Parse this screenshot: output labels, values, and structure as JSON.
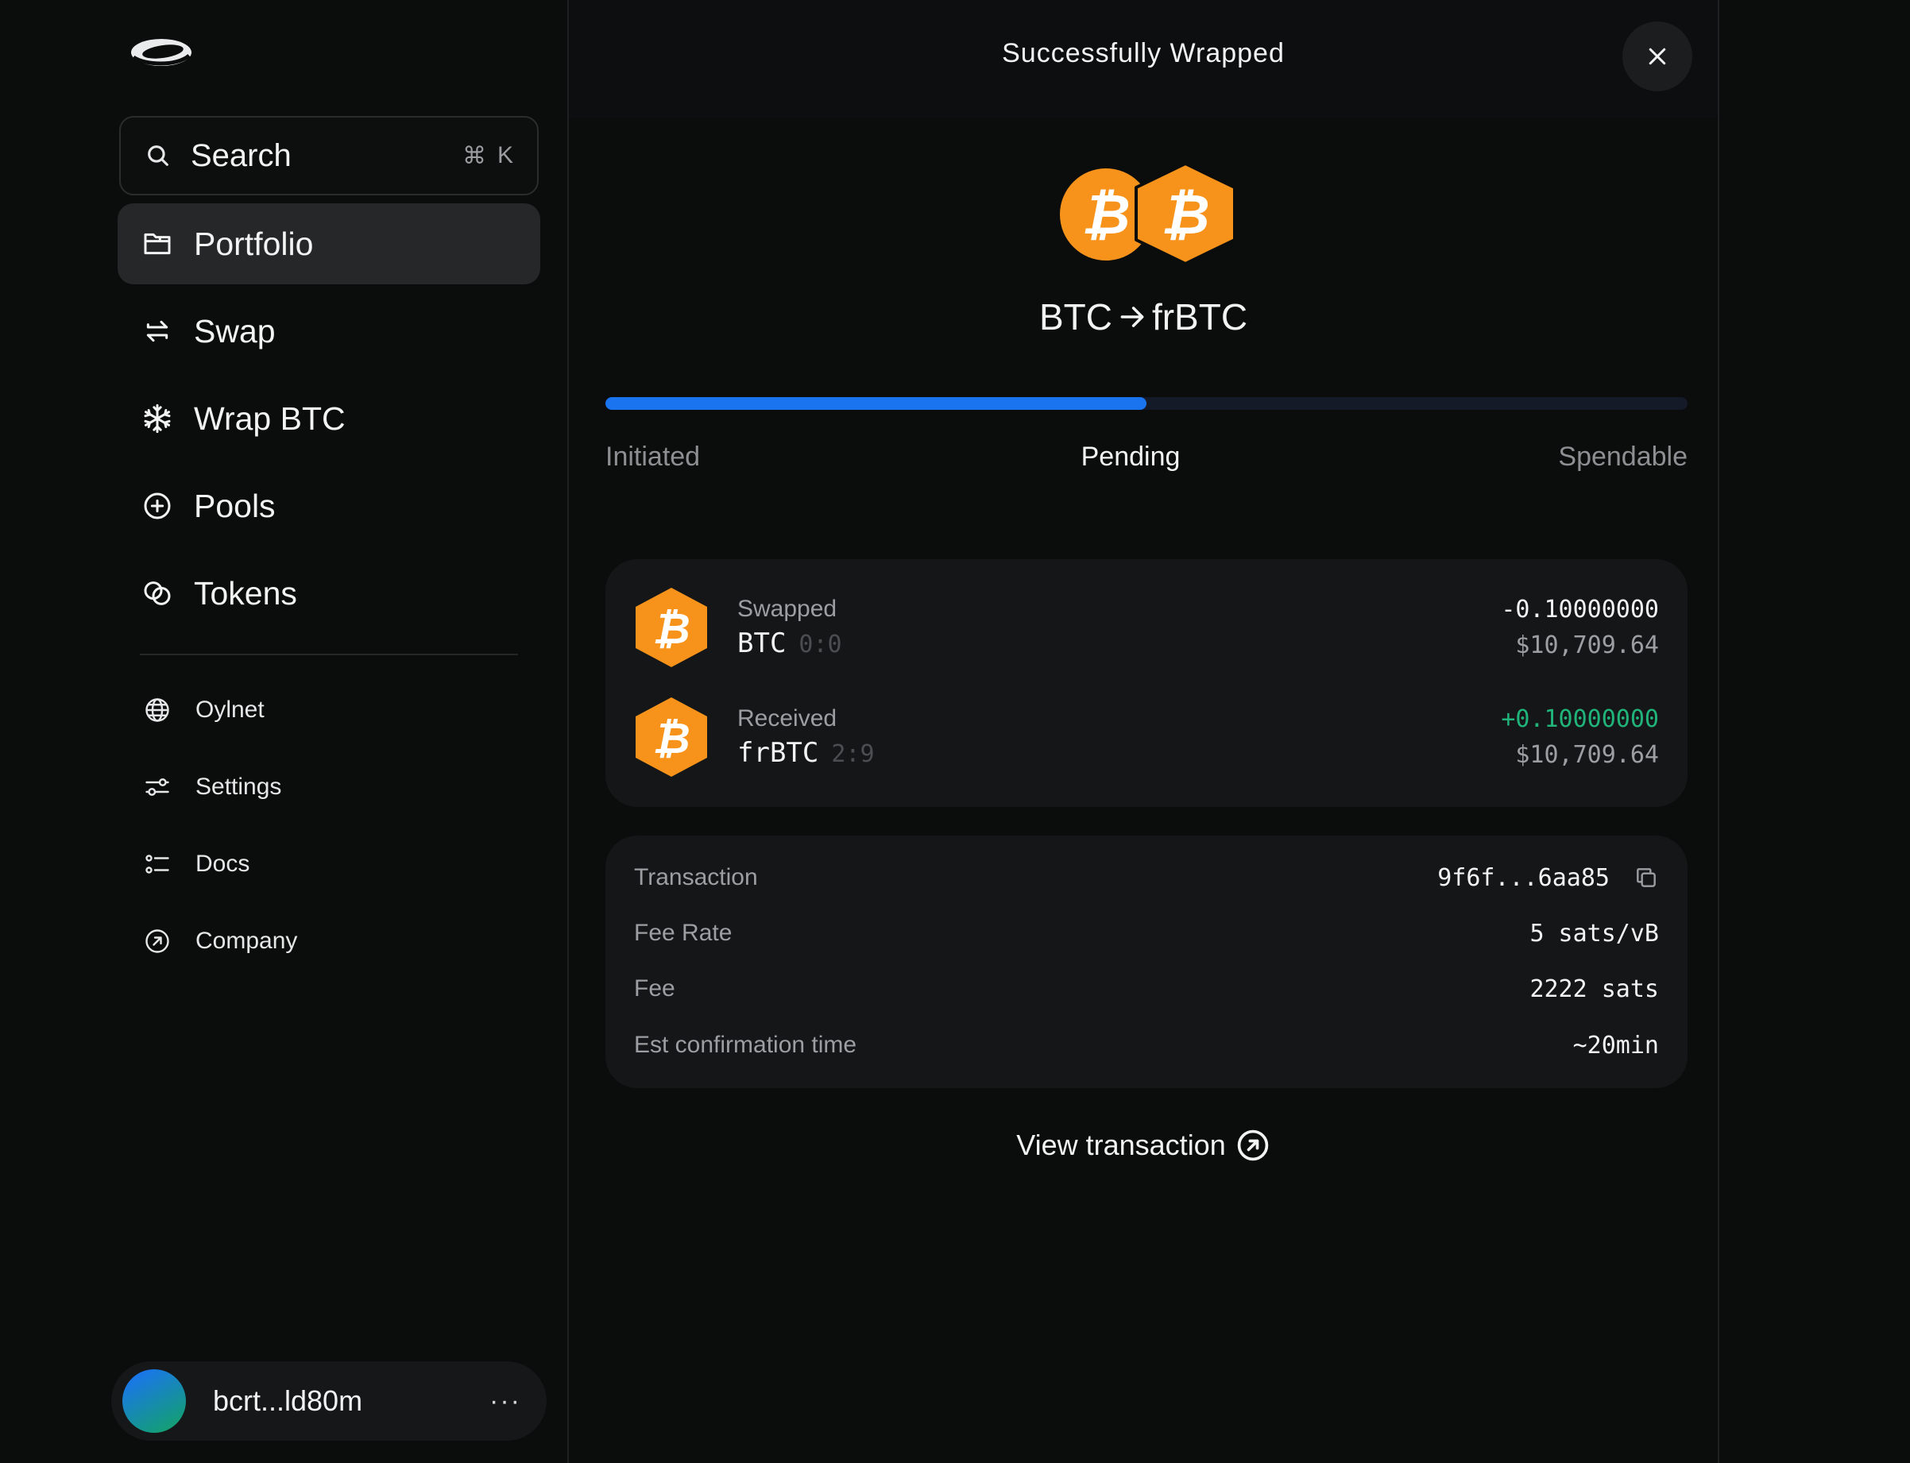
{
  "sidebar": {
    "search": {
      "placeholder": "Search",
      "shortcut_symbol": "⌘",
      "shortcut_key": "K"
    },
    "nav": [
      {
        "label": "Portfolio",
        "icon": "folder-icon",
        "active": true
      },
      {
        "label": "Swap",
        "icon": "swap-icon"
      },
      {
        "label": "Wrap BTC",
        "icon": "snowflake-icon"
      },
      {
        "label": "Pools",
        "icon": "plus-circle-icon"
      },
      {
        "label": "Tokens",
        "icon": "tokens-icon"
      }
    ],
    "secondary": [
      {
        "label": "Oylnet",
        "icon": "globe-icon"
      },
      {
        "label": "Settings",
        "icon": "sliders-icon"
      },
      {
        "label": "Docs",
        "icon": "list-icon"
      },
      {
        "label": "Company",
        "icon": "arrow-up-right-circle-icon"
      }
    ],
    "account": {
      "address": "bcrt...ld80m",
      "more": "···"
    }
  },
  "modal": {
    "title": "Successfully Wrapped",
    "pair": {
      "from": "BTC",
      "to": "frBTC"
    },
    "progress": {
      "fraction": 0.5,
      "steps": [
        "Initiated",
        "Pending",
        "Spendable"
      ],
      "current_step": "Pending"
    },
    "swap": [
      {
        "label": "Swapped",
        "token": "BTC",
        "id": "0:0",
        "amount": "-0.10000000",
        "usd": "$10,709.64",
        "direction": "out"
      },
      {
        "label": "Received",
        "token": "frBTC",
        "id": "2:9",
        "amount": "+0.10000000",
        "usd": "$10,709.64",
        "direction": "in"
      }
    ],
    "details": [
      {
        "label": "Transaction",
        "value": "9f6f...6aa85"
      },
      {
        "label": "Fee Rate",
        "value": "5 sats/vB"
      },
      {
        "label": "Fee",
        "value": "2222 sats"
      },
      {
        "label": "Est confirmation time",
        "value": "~20min"
      }
    ],
    "view_tx_label": "View transaction"
  },
  "colors": {
    "accent": "#1a74f0",
    "bitcoin": "#f7931a",
    "positive": "#20b47a",
    "background": "#0b0c0c",
    "card": "#141617"
  }
}
